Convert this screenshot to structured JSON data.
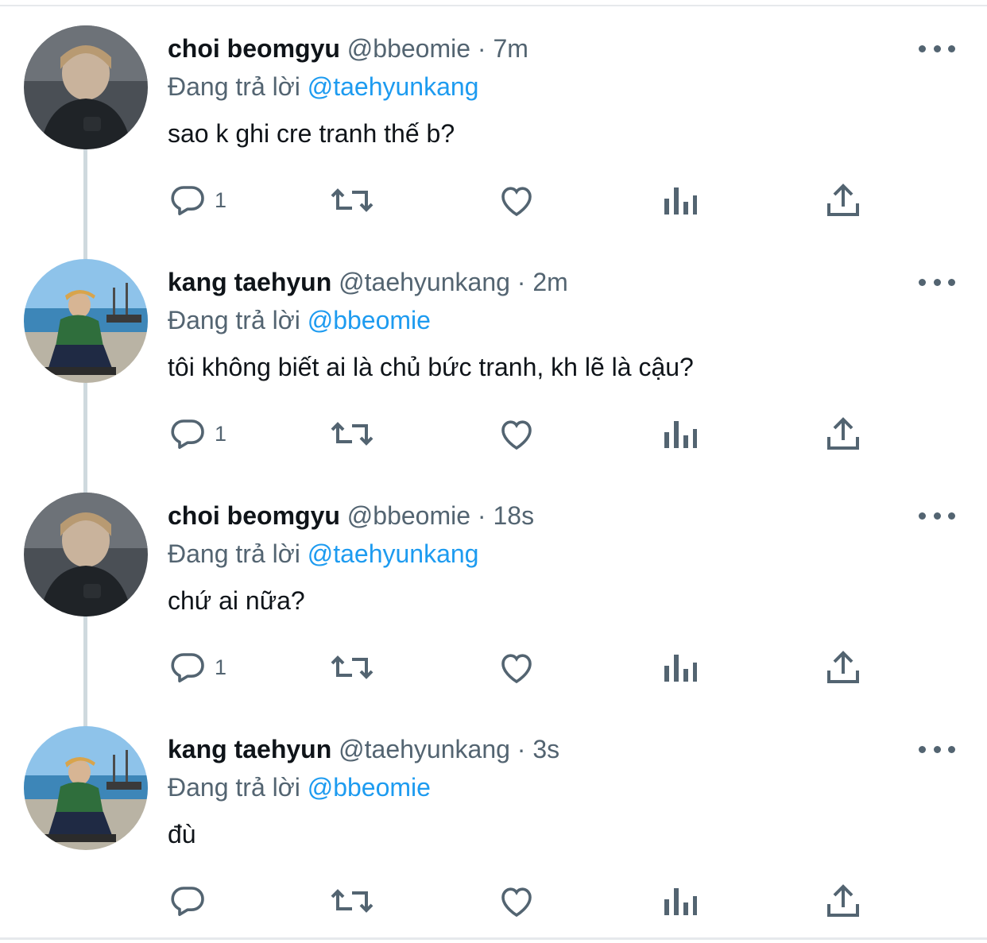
{
  "reply_prefix": "Đang trả lời",
  "tweets": [
    {
      "name": "choi beomgyu",
      "handle": "@bbeomie",
      "separator": "·",
      "time": "7m",
      "reply_to": "@taehyunkang",
      "text": "sao k ghi cre tranh thế b?",
      "reply_count": "1",
      "avatar": "avatar-beomgyu"
    },
    {
      "name": "kang taehyun",
      "handle": "@taehyunkang",
      "separator": "·",
      "time": "2m",
      "reply_to": "@bbeomie",
      "text": "tôi không biết ai là chủ bức tranh, kh lẽ là cậu?",
      "reply_count": "1",
      "avatar": "avatar-taehyun"
    },
    {
      "name": "choi beomgyu",
      "handle": "@bbeomie",
      "separator": "·",
      "time": "18s",
      "reply_to": "@taehyunkang",
      "text": "chứ ai nữa?",
      "reply_count": "1",
      "avatar": "avatar-beomgyu"
    },
    {
      "name": "kang taehyun",
      "handle": "@taehyunkang",
      "separator": "·",
      "time": "3s",
      "reply_to": "@bbeomie",
      "text": "đù",
      "reply_count": "",
      "avatar": "avatar-taehyun"
    }
  ],
  "icons": {
    "reply": "reply-icon",
    "retweet": "retweet-icon",
    "like": "like-icon",
    "views": "views-icon",
    "share": "share-icon",
    "more": "more-icon"
  },
  "colors": {
    "text": "#0f1419",
    "secondary": "#536471",
    "mention": "#1d9bf0",
    "thread_line": "#cfd9de"
  }
}
